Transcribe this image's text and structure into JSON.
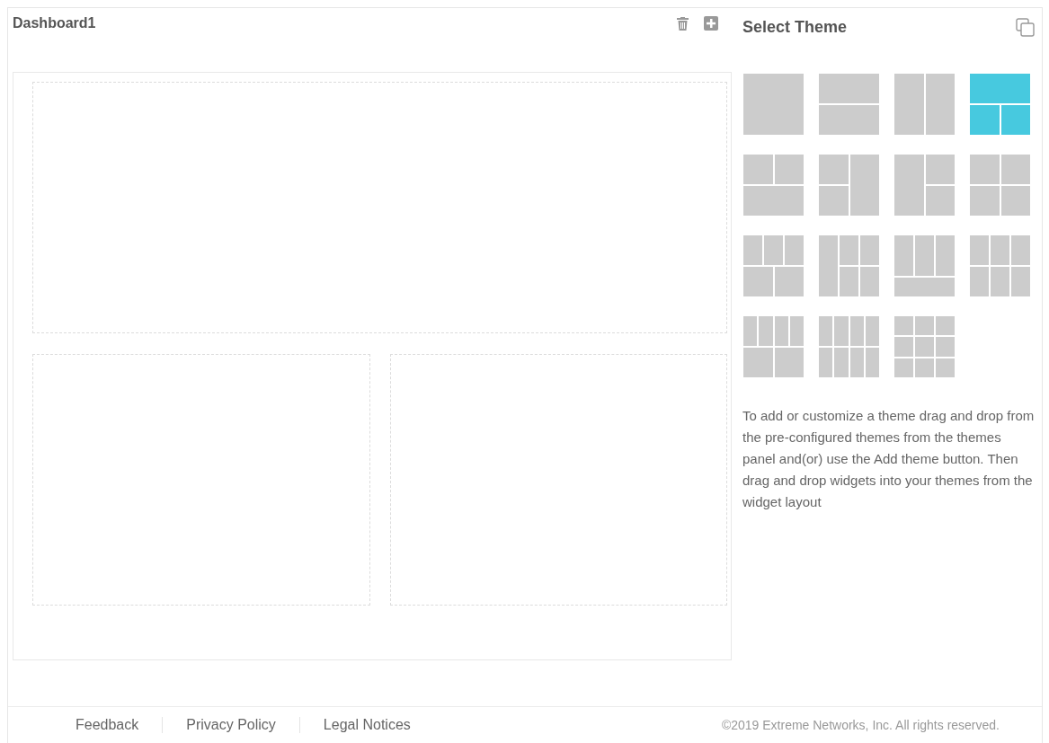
{
  "dashboard": {
    "title": "Dashboard1"
  },
  "theme_panel": {
    "title": "Select Theme",
    "themes": [
      {
        "kind": "full",
        "selected": false
      },
      {
        "kind": "rows2",
        "selected": false
      },
      {
        "kind": "cols2",
        "selected": false
      },
      {
        "kind": "top1bottom2",
        "selected": true
      },
      {
        "kind": "top2bottom1",
        "selected": false
      },
      {
        "kind": "left2right1",
        "selected": false
      },
      {
        "kind": "left1right2",
        "selected": false
      },
      {
        "kind": "grid2x2",
        "selected": false
      },
      {
        "kind": "top3bottom2",
        "selected": false
      },
      {
        "kind": "left1grid2x2",
        "selected": false
      },
      {
        "kind": "top3bottom1",
        "selected": false
      },
      {
        "kind": "grid3x2",
        "selected": false
      },
      {
        "kind": "top4bottom2",
        "selected": false
      },
      {
        "kind": "grid4x2",
        "selected": false
      },
      {
        "kind": "grid3x3",
        "selected": false
      }
    ],
    "description": "To add or customize a theme drag and drop from the pre-configured themes from the themes panel and(or) use the Add theme button. Then drag and drop widgets into your themes from the widget layout"
  },
  "footer": {
    "links": [
      "Feedback",
      "Privacy Policy",
      "Legal Notices"
    ],
    "copyright": "©2019 Extreme Networks, Inc. All rights reserved."
  }
}
